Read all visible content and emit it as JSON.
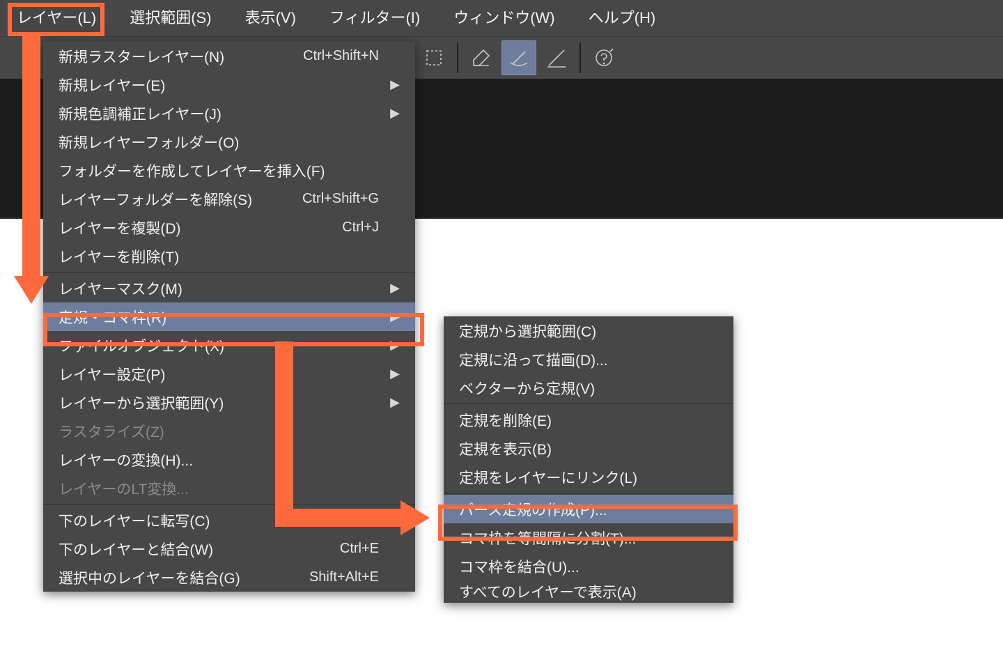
{
  "annotation_color": "#ff6a3d",
  "menubar": {
    "items": [
      {
        "label": "レイヤー(L)",
        "highlighted": true
      },
      {
        "label": "選択範囲(S)"
      },
      {
        "label": "表示(V)"
      },
      {
        "label": "フィルター(I)"
      },
      {
        "label": "ウィンドウ(W)"
      },
      {
        "label": "ヘルプ(H)"
      }
    ]
  },
  "toolbar": {
    "icons": [
      {
        "name": "selection-icon",
        "active": false
      },
      {
        "name": "sep"
      },
      {
        "name": "pen-edit-icon",
        "active": false
      },
      {
        "name": "brush-icon",
        "active": true
      },
      {
        "name": "edit-line-icon",
        "active": false
      },
      {
        "name": "sep"
      },
      {
        "name": "help-bubble-icon",
        "active": false
      }
    ]
  },
  "layer_menu": {
    "items": [
      {
        "label": "新規ラスターレイヤー(N)",
        "shortcut": "Ctrl+Shift+N"
      },
      {
        "label": "新規レイヤー(E)",
        "submenu": true
      },
      {
        "label": "新規色調補正レイヤー(J)",
        "submenu": true
      },
      {
        "label": "新規レイヤーフォルダー(O)"
      },
      {
        "label": "フォルダーを作成してレイヤーを挿入(F)"
      },
      {
        "label": "レイヤーフォルダーを解除(S)",
        "shortcut": "Ctrl+Shift+G"
      },
      {
        "label": "レイヤーを複製(D)",
        "shortcut": "Ctrl+J"
      },
      {
        "label": "レイヤーを削除(T)"
      },
      {
        "sep": true
      },
      {
        "label": "レイヤーマスク(M)",
        "submenu": true
      },
      {
        "label": "定規・コマ枠(R)",
        "submenu": true,
        "hover": true
      },
      {
        "label": "ファイルオブジェクト(X)",
        "submenu": true
      },
      {
        "label": "レイヤー設定(P)",
        "submenu": true
      },
      {
        "label": "レイヤーから選択範囲(Y)",
        "submenu": true
      },
      {
        "label": "ラスタライズ(Z)",
        "disabled": true
      },
      {
        "label": "レイヤーの変換(H)..."
      },
      {
        "label": "レイヤーのLT変換...",
        "disabled": true
      },
      {
        "sep": true
      },
      {
        "label": "下のレイヤーに転写(C)"
      },
      {
        "label": "下のレイヤーと結合(W)",
        "shortcut": "Ctrl+E"
      },
      {
        "label": "選択中のレイヤーを結合(G)",
        "shortcut": "Shift+Alt+E"
      }
    ]
  },
  "ruler_menu": {
    "items": [
      {
        "label": "定規から選択範囲(C)"
      },
      {
        "label": "定規に沿って描画(D)..."
      },
      {
        "label": "ベクターから定規(V)"
      },
      {
        "sep": true
      },
      {
        "label": "定規を削除(E)"
      },
      {
        "label": "定規を表示(B)"
      },
      {
        "label": "定規をレイヤーにリンク(L)"
      },
      {
        "sep": true
      },
      {
        "label": "パース定規の作成(P)...",
        "hover": true
      },
      {
        "label": "コマ枠を等間隔に分割(T)..."
      },
      {
        "label": "コマ枠を結合(U)..."
      },
      {
        "label": "すべてのレイヤーで表示(A)",
        "cut": true
      }
    ]
  }
}
